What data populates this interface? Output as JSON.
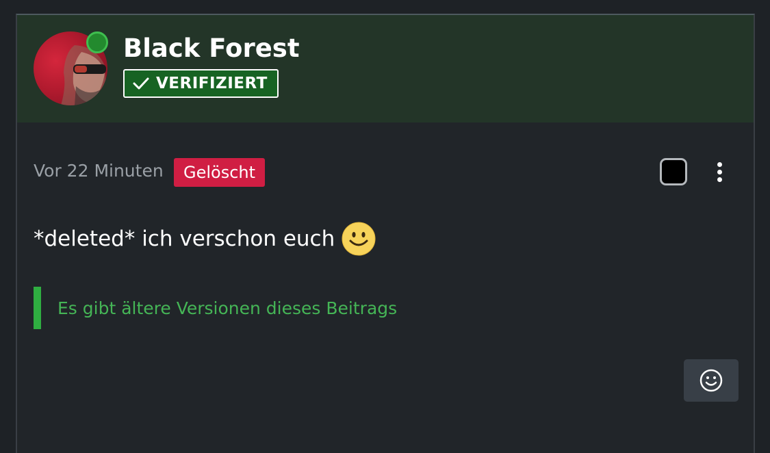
{
  "post": {
    "author": {
      "name": "Black Forest",
      "verified_label": "VERIFIZIERT",
      "online": true
    },
    "meta": {
      "time": "Vor 22 Minuten",
      "status_badge": "Gelöscht"
    },
    "message": {
      "text": "*deleted* ich verschon euch",
      "emoji": "smiley-icon"
    },
    "versions_notice": "Es gibt ältere Versionen dieses Beitrags",
    "actions": {
      "select_checkbox": "checked",
      "more_menu": "kebab-icon",
      "react_button": "smiley-icon"
    }
  },
  "colors": {
    "header_bg": "#233528",
    "verified_bg": "#176323",
    "deleted_badge": "#d01e43",
    "accent_green": "#2fae41",
    "card_bg": "#212529"
  }
}
